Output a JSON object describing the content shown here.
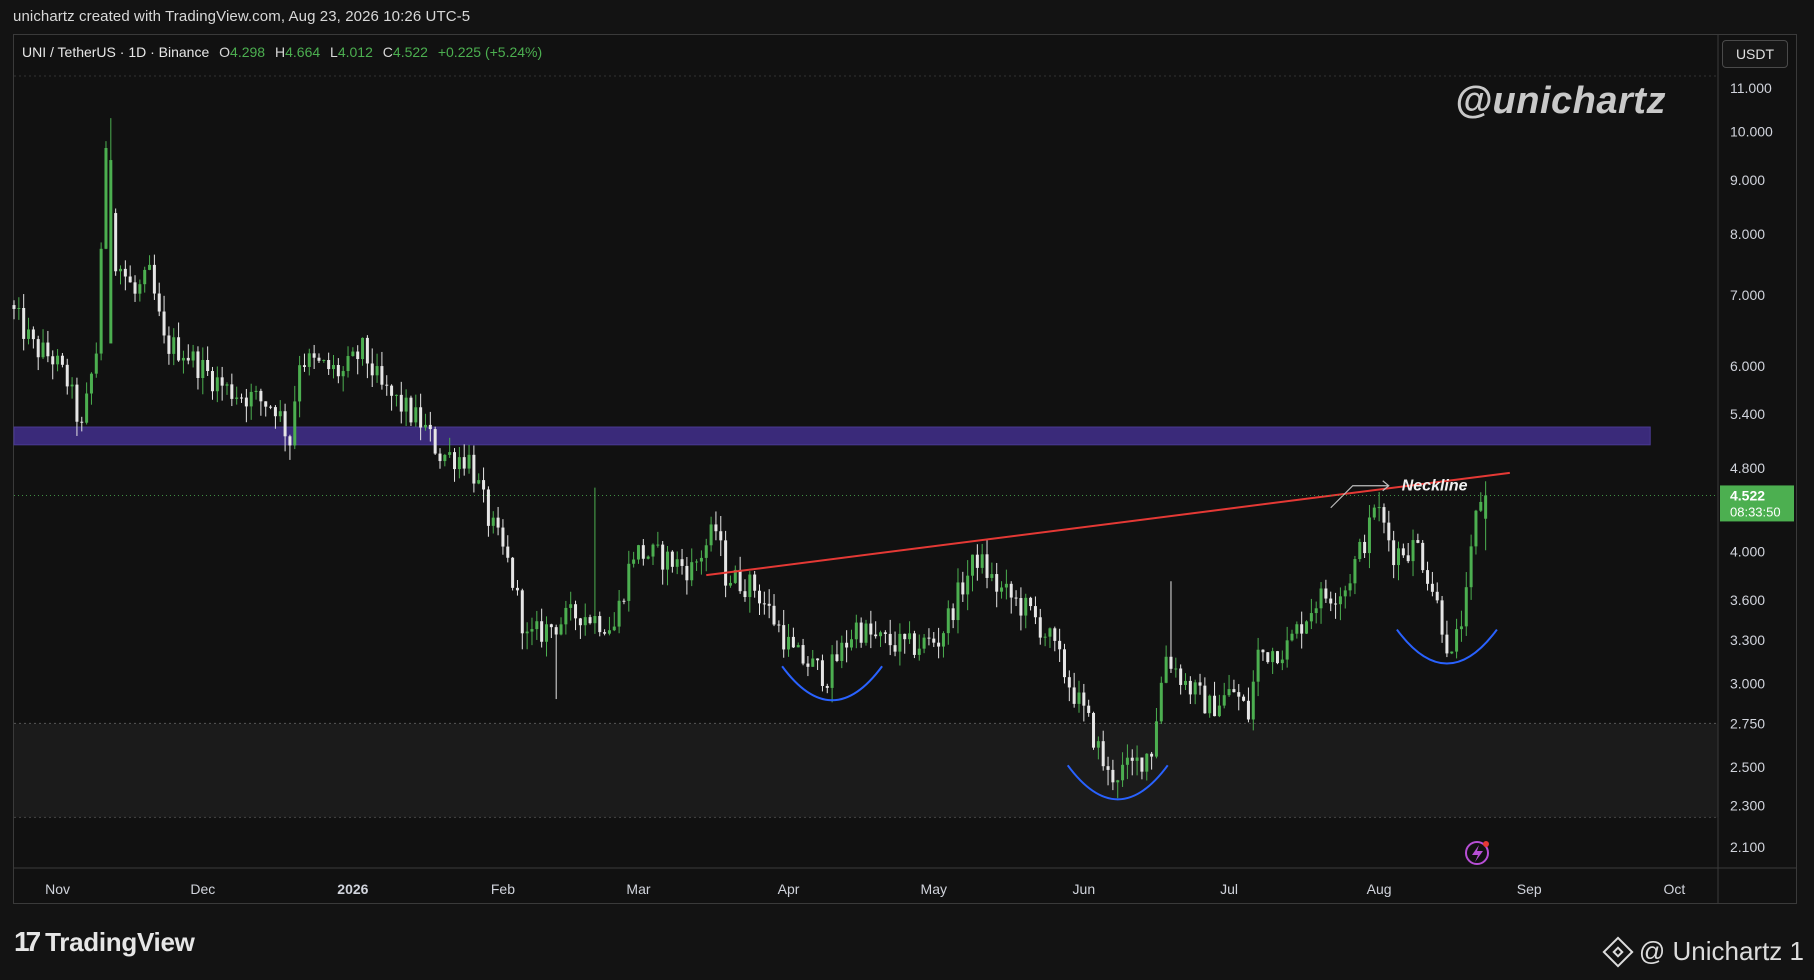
{
  "header": {
    "created_by": "unichartz created with TradingView.com, Aug 23, 2026 10:26 UTC-5"
  },
  "legend": {
    "symbol": "UNI / TetherUS · 1D · Binance",
    "open_label": "O",
    "open": "4.298",
    "high_label": "H",
    "high": "4.664",
    "low_label": "L",
    "low": "4.012",
    "close_label": "C",
    "close": "4.522",
    "change": "+0.225 (+5.24%)"
  },
  "currency_button": "USDT",
  "watermark": "@unichartz",
  "footer": {
    "logo": "TradingView",
    "credit": "@ Unichartz 1"
  },
  "colors": {
    "background": "#111111",
    "up_candle": "#4caf50",
    "down_candle": "#e6e6e6",
    "resistance_zone": "#3a2a7a",
    "neckline": "#e53935",
    "pattern_arcs": "#2962ff",
    "price_label_bg": "#4caf50"
  },
  "chart_data": {
    "type": "candlestick",
    "title": "UNI / TetherUS · 1D · Binance",
    "y_scale": "log",
    "y_ticks": [
      11.0,
      10.0,
      9.0,
      8.0,
      7.0,
      6.0,
      5.4,
      4.8,
      4.0,
      3.6,
      3.3,
      3.0,
      2.75,
      2.5,
      2.3,
      2.1
    ],
    "y_tick_labels": [
      "11.000",
      "10.000",
      "9.000",
      "8.000",
      "7.000",
      "6.000",
      "5.400",
      "4.800",
      "4.000",
      "3.600",
      "3.300",
      "3.000",
      "2.750",
      "2.500",
      "2.300",
      "2.100"
    ],
    "x_range": [
      "2025-10-23",
      "2026-10-10"
    ],
    "x_ticks": [
      {
        "date": "2025-11-01",
        "label": "Nov"
      },
      {
        "date": "2025-12-01",
        "label": "Dec"
      },
      {
        "date": "2026-01-01",
        "label": "2026"
      },
      {
        "date": "2026-02-01",
        "label": "Feb"
      },
      {
        "date": "2026-03-01",
        "label": "Mar"
      },
      {
        "date": "2026-04-01",
        "label": "Apr"
      },
      {
        "date": "2026-05-01",
        "label": "May"
      },
      {
        "date": "2026-06-01",
        "label": "Jun"
      },
      {
        "date": "2026-07-01",
        "label": "Jul"
      },
      {
        "date": "2026-08-01",
        "label": "Aug"
      },
      {
        "date": "2026-09-01",
        "label": "Sep"
      },
      {
        "date": "2026-10-01",
        "label": "Oct"
      }
    ],
    "last_price": {
      "value": 4.522,
      "label": "4.522",
      "countdown": "08:33:50"
    },
    "resistance_zone": {
      "low": 5.05,
      "high": 5.25,
      "from": "2025-10-23",
      "to": "2026-09-26"
    },
    "neckline": {
      "label": "Neckline",
      "from": {
        "date": "2026-03-15",
        "price": 3.8
      },
      "to": {
        "date": "2026-08-28",
        "price": 4.75
      }
    },
    "pattern_arcs": [
      {
        "name": "left shoulder",
        "center_date": "2026-04-10",
        "low_price": 2.88
      },
      {
        "name": "head",
        "center_date": "2026-06-08",
        "low_price": 2.32
      },
      {
        "name": "right shoulder",
        "center_date": "2026-08-15",
        "low_price": 3.12
      }
    ],
    "anchors": [
      {
        "date": "2025-10-23",
        "close": 6.85
      },
      {
        "date": "2025-10-28",
        "close": 6.25
      },
      {
        "date": "2025-11-01",
        "close": 6.1
      },
      {
        "date": "2025-11-04",
        "close": 5.8
      },
      {
        "date": "2025-11-07",
        "close": 5.2
      },
      {
        "date": "2025-11-10",
        "close": 6.2
      },
      {
        "date": "2025-11-12",
        "close": 9.4
      },
      {
        "date": "2025-11-14",
        "close": 7.6
      },
      {
        "date": "2025-11-18",
        "close": 7.0
      },
      {
        "date": "2025-11-21",
        "close": 7.3
      },
      {
        "date": "2025-11-24",
        "close": 6.3
      },
      {
        "date": "2025-11-28",
        "close": 6.2
      },
      {
        "date": "2025-12-03",
        "close": 5.9
      },
      {
        "date": "2025-12-07",
        "close": 5.7
      },
      {
        "date": "2025-12-12",
        "close": 5.6
      },
      {
        "date": "2025-12-17",
        "close": 5.5
      },
      {
        "date": "2025-12-20",
        "close": 5.1
      },
      {
        "date": "2025-12-22",
        "close": 6.1
      },
      {
        "date": "2025-12-26",
        "close": 6.0
      },
      {
        "date": "2025-12-31",
        "close": 5.9
      },
      {
        "date": "2026-01-04",
        "close": 6.2
      },
      {
        "date": "2026-01-08",
        "close": 5.7
      },
      {
        "date": "2026-01-12",
        "close": 5.5
      },
      {
        "date": "2026-01-16",
        "close": 5.3
      },
      {
        "date": "2026-01-20",
        "close": 4.95
      },
      {
        "date": "2026-01-26",
        "close": 4.9
      },
      {
        "date": "2026-01-30",
        "close": 4.3
      },
      {
        "date": "2026-02-03",
        "close": 3.9
      },
      {
        "date": "2026-02-07",
        "close": 3.3
      },
      {
        "date": "2026-02-12",
        "close": 3.4
      },
      {
        "date": "2026-02-18",
        "close": 3.5
      },
      {
        "date": "2026-02-25",
        "close": 3.4
      },
      {
        "date": "2026-03-01",
        "close": 4.0
      },
      {
        "date": "2026-03-07",
        "close": 3.95
      },
      {
        "date": "2026-03-13",
        "close": 3.85
      },
      {
        "date": "2026-03-18",
        "close": 4.2
      },
      {
        "date": "2026-03-20",
        "close": 3.8
      },
      {
        "date": "2026-03-26",
        "close": 3.7
      },
      {
        "date": "2026-04-03",
        "close": 3.2
      },
      {
        "date": "2026-04-10",
        "close": 3.05
      },
      {
        "date": "2026-04-16",
        "close": 3.4
      },
      {
        "date": "2026-04-20",
        "close": 3.3
      },
      {
        "date": "2026-04-27",
        "close": 3.25
      },
      {
        "date": "2026-05-03",
        "close": 3.3
      },
      {
        "date": "2026-05-09",
        "close": 3.8
      },
      {
        "date": "2026-05-11",
        "close": 3.95
      },
      {
        "date": "2026-05-15",
        "close": 3.7
      },
      {
        "date": "2026-05-22",
        "close": 3.5
      },
      {
        "date": "2026-05-26",
        "close": 3.3
      },
      {
        "date": "2026-05-30",
        "close": 3.0
      },
      {
        "date": "2026-06-03",
        "close": 2.75
      },
      {
        "date": "2026-06-07",
        "close": 2.45
      },
      {
        "date": "2026-06-12",
        "close": 2.5
      },
      {
        "date": "2026-06-16",
        "close": 2.6
      },
      {
        "date": "2026-06-19",
        "close": 3.2
      },
      {
        "date": "2026-06-23",
        "close": 3.0
      },
      {
        "date": "2026-06-28",
        "close": 2.85
      },
      {
        "date": "2026-07-03",
        "close": 2.95
      },
      {
        "date": "2026-07-06",
        "close": 2.8
      },
      {
        "date": "2026-07-08",
        "close": 3.2
      },
      {
        "date": "2026-07-14",
        "close": 3.25
      },
      {
        "date": "2026-07-20",
        "close": 3.6
      },
      {
        "date": "2026-07-26",
        "close": 3.7
      },
      {
        "date": "2026-07-31",
        "close": 4.2
      },
      {
        "date": "2026-08-01",
        "close": 4.45
      },
      {
        "date": "2026-08-05",
        "close": 4.0
      },
      {
        "date": "2026-08-10",
        "close": 4.05
      },
      {
        "date": "2026-08-13",
        "close": 3.7
      },
      {
        "date": "2026-08-17",
        "close": 3.15
      },
      {
        "date": "2026-08-20",
        "close": 3.6
      },
      {
        "date": "2026-08-22",
        "close": 4.3
      },
      {
        "date": "2026-08-23",
        "close": 4.52
      }
    ]
  }
}
